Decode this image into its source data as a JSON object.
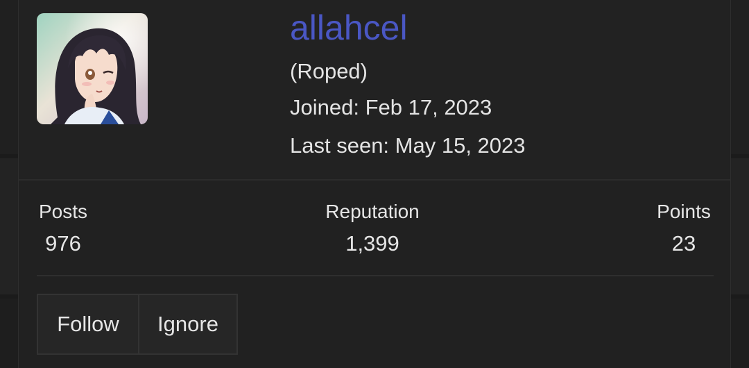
{
  "profile": {
    "username": "allahcel",
    "user_title": "(Roped)",
    "joined": "Joined: Feb 17, 2023",
    "last_seen": "Last seen: May 15, 2023",
    "avatar_icon": "anime-avatar-image"
  },
  "stats": {
    "posts_label": "Posts",
    "posts_value": "976",
    "reputation_label": "Reputation",
    "reputation_value": "1,399",
    "points_label": "Points",
    "points_value": "23"
  },
  "actions": {
    "follow_label": "Follow",
    "ignore_label": "Ignore"
  },
  "colors": {
    "username": "#4a57c4",
    "background": "#1b1b1b",
    "card": "#212121"
  }
}
